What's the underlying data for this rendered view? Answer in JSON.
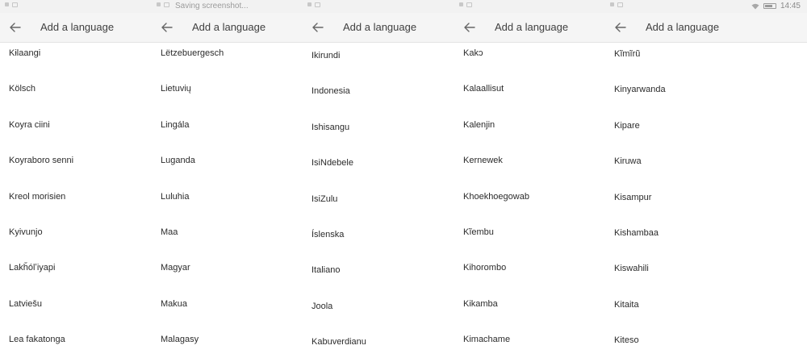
{
  "panels": [
    {
      "title": "Add a language",
      "status": {
        "text": ""
      },
      "items": [
        "Kɨlaangi",
        "Kölsch",
        "Koyra ciini",
        "Koyraboro senni",
        "Kreol morisien",
        "Kyivunjo",
        "Lakȟólʼiyapi",
        "Latviešu",
        "Lea fakatonga"
      ]
    },
    {
      "title": "Add a language",
      "status": {
        "text": "Saving screenshot..."
      },
      "items": [
        "Lëtzebuergesch",
        "Lietuvių",
        "Lingála",
        "Luganda",
        "Luluhia",
        "Maa",
        "Magyar",
        "Makua",
        "Malagasy"
      ]
    },
    {
      "title": "Add a language",
      "status": {
        "text": ""
      },
      "items": [
        "Ikirundi",
        "Indonesia",
        "Ishisangu",
        "IsiNdebele",
        "IsiZulu",
        "Íslenska",
        "Italiano",
        "Joola",
        "Kabuverdianu"
      ]
    },
    {
      "title": "Add a language",
      "status": {
        "text": ""
      },
      "items": [
        "Kakɔ",
        "Kalaallisut",
        "Kalenjin",
        "Kernewek",
        "Khoekhoegowab",
        "Kĩembu",
        "Kihorombo",
        "Kikamba",
        "Kimachame"
      ]
    },
    {
      "title": "Add a language",
      "status": {
        "text": "",
        "time": "14:45"
      },
      "items": [
        "Kĩmĩrũ",
        "Kinyarwanda",
        "Kipare",
        "Kiruwa",
        "Kisampur",
        "Kishambaa",
        "Kiswahili",
        "Kitaita",
        "Kiteso"
      ]
    }
  ],
  "icons": {
    "back": "arrow-left-icon",
    "wifi": "wifi-icon",
    "battery": "battery-icon",
    "notification": "image-notification-icon"
  }
}
